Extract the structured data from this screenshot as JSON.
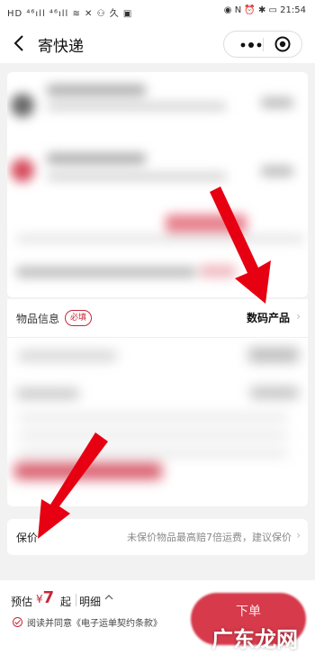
{
  "status_bar": {
    "left": "HD ⁴⁶ıll ⁴⁶ıll ≋ ✕ ⚇ 久 ▣",
    "right": "◉ N ⏰ ✱ ▭ 21:54"
  },
  "nav": {
    "title": "寄快递"
  },
  "goods": {
    "label": "物品信息",
    "badge": "必填",
    "value": "数码产品"
  },
  "insurance": {
    "label": "保价",
    "hint": "未保价物品最高赔7倍运费，建议保价"
  },
  "bottom": {
    "est_label": "预估",
    "currency": "¥",
    "price": "7",
    "from": "起",
    "detail": "明细",
    "agree": "阅读并同意《电子运单契约条款》",
    "order": "下单"
  },
  "watermark": "广东龙网",
  "colors": {
    "accent": "#c9283a",
    "arrow": "#e60012"
  }
}
